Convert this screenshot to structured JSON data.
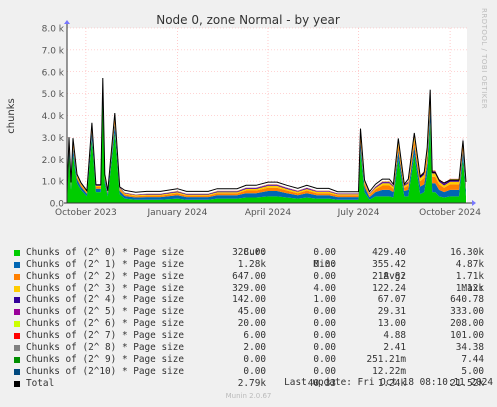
{
  "side_label": "RRDTOOL / TOBI OETIKER",
  "footer": {
    "last_update": "Last update: Fri Oct 18 08:10:11 2024",
    "generator": "Munin 2.0.67"
  },
  "legend_header": {
    "cur": "Cur:",
    "min": "Min:",
    "avg": "Avg:",
    "max": "Max:"
  },
  "legend": [
    {
      "name": "Chunks of (2^ 0) * Page size",
      "color": "#00cc00",
      "cur": "328.00",
      "min": "0.00",
      "avg": "429.40",
      "max": "16.30k"
    },
    {
      "name": "Chunks of (2^ 1) * Page size",
      "color": "#0066b3",
      "cur": "1.28k",
      "min": "0.00",
      "avg": "355.42",
      "max": "4.87k"
    },
    {
      "name": "Chunks of (2^ 2) * Page size",
      "color": "#ff8000",
      "cur": "647.00",
      "min": "0.00",
      "avg": "218.82",
      "max": "1.71k"
    },
    {
      "name": "Chunks of (2^ 3) * Page size",
      "color": "#ffcc00",
      "cur": "329.00",
      "min": "4.00",
      "avg": "122.24",
      "max": "1.12k"
    },
    {
      "name": "Chunks of (2^ 4) * Page size",
      "color": "#330099",
      "cur": "142.00",
      "min": "1.00",
      "avg": "67.07",
      "max": "640.78"
    },
    {
      "name": "Chunks of (2^ 5) * Page size",
      "color": "#990099",
      "cur": "45.00",
      "min": "0.00",
      "avg": "29.31",
      "max": "333.00"
    },
    {
      "name": "Chunks of (2^ 6) * Page size",
      "color": "#ccff00",
      "cur": "20.00",
      "min": "0.00",
      "avg": "13.00",
      "max": "208.00"
    },
    {
      "name": "Chunks of (2^ 7) * Page size",
      "color": "#ff0000",
      "cur": "6.00",
      "min": "0.00",
      "avg": "4.88",
      "max": "101.00"
    },
    {
      "name": "Chunks of (2^ 8) * Page size",
      "color": "#808080",
      "cur": "2.00",
      "min": "0.00",
      "avg": "2.41",
      "max": "34.38"
    },
    {
      "name": "Chunks of (2^ 9) * Page size",
      "color": "#008f00",
      "cur": "0.00",
      "min": "0.00",
      "avg": "251.21m",
      "max": "7.44"
    },
    {
      "name": "Chunks of (2^10) * Page size",
      "color": "#00487d",
      "cur": "0.00",
      "min": "0.00",
      "avg": "12.22m",
      "max": "5.00"
    },
    {
      "name": "Total",
      "color": "#000000",
      "cur": "2.79k",
      "min": "40.33",
      "avg": "1.24k",
      "max": "21.52k"
    }
  ],
  "chart_data": {
    "type": "area",
    "title": "Node 0, zone Normal - by year",
    "ylabel": "chunks",
    "ylim": [
      0,
      8000
    ],
    "xlim": [
      "2023-09-12",
      "2024-10-18"
    ],
    "yticks": [
      {
        "value": 0,
        "label": "0.0"
      },
      {
        "value": 1000,
        "label": "1.0 k"
      },
      {
        "value": 2000,
        "label": "2.0 k"
      },
      {
        "value": 3000,
        "label": "3.0 k"
      },
      {
        "value": 4000,
        "label": "4.0 k"
      },
      {
        "value": 5000,
        "label": "5.0 k"
      },
      {
        "value": 6000,
        "label": "6.0 k"
      },
      {
        "value": 7000,
        "label": "7.0 k"
      },
      {
        "value": 8000,
        "label": "8.0 k"
      }
    ],
    "xticks": [
      {
        "value": "2023-10-01",
        "label": "October 2023"
      },
      {
        "value": "2024-01-01",
        "label": "January 2024"
      },
      {
        "value": "2024-04-01",
        "label": "April 2024"
      },
      {
        "value": "2024-07-01",
        "label": "July 2024"
      },
      {
        "value": "2024-10-01",
        "label": "October 2024"
      }
    ],
    "grid": true,
    "x": [
      "2023-09-12",
      "2023-09-14",
      "2023-09-16",
      "2023-09-18",
      "2023-09-22",
      "2023-09-26",
      "2023-10-02",
      "2023-10-07",
      "2023-10-11",
      "2023-10-16",
      "2023-10-18",
      "2023-10-20",
      "2023-10-23",
      "2023-10-30",
      "2023-11-04",
      "2023-11-09",
      "2023-11-20",
      "2023-12-01",
      "2023-12-15",
      "2024-01-01",
      "2024-01-10",
      "2024-01-20",
      "2024-02-01",
      "2024-02-10",
      "2024-02-20",
      "2024-03-01",
      "2024-03-10",
      "2024-03-20",
      "2024-04-01",
      "2024-04-10",
      "2024-04-20",
      "2024-05-01",
      "2024-05-10",
      "2024-05-20",
      "2024-06-01",
      "2024-06-10",
      "2024-06-20",
      "2024-07-01",
      "2024-07-03",
      "2024-07-07",
      "2024-07-12",
      "2024-07-18",
      "2024-07-25",
      "2024-08-01",
      "2024-08-05",
      "2024-08-10",
      "2024-08-16",
      "2024-08-20",
      "2024-08-26",
      "2024-09-01",
      "2024-09-05",
      "2024-09-08",
      "2024-09-11",
      "2024-09-13",
      "2024-09-16",
      "2024-09-20",
      "2024-09-25",
      "2024-10-01",
      "2024-10-05",
      "2024-10-10",
      "2024-10-14",
      "2024-10-17"
    ],
    "series": [
      {
        "name": "Chunks of (2^ 0) * Page size",
        "color": "#00cc00",
        "values": [
          150,
          2300,
          600,
          2200,
          900,
          600,
          300,
          2900,
          500,
          500,
          4800,
          900,
          300,
          3200,
          400,
          200,
          150,
          150,
          150,
          200,
          150,
          150,
          150,
          200,
          200,
          200,
          250,
          250,
          300,
          300,
          250,
          200,
          250,
          200,
          200,
          150,
          150,
          150,
          2400,
          500,
          150,
          300,
          300,
          300,
          250,
          2000,
          300,
          300,
          2200,
          400,
          500,
          1300,
          3700,
          500,
          500,
          300,
          250,
          300,
          300,
          300,
          2000,
          300
        ]
      },
      {
        "name": "Chunks of (2^ 1) * Page size",
        "color": "#0066b3",
        "values": [
          100,
          300,
          150,
          350,
          200,
          150,
          120,
          350,
          150,
          150,
          400,
          200,
          120,
          400,
          150,
          120,
          100,
          120,
          120,
          150,
          120,
          120,
          120,
          150,
          150,
          150,
          200,
          200,
          250,
          250,
          200,
          150,
          200,
          150,
          150,
          120,
          120,
          120,
          400,
          250,
          120,
          200,
          300,
          300,
          250,
          400,
          250,
          300,
          400,
          350,
          350,
          500,
          600,
          400,
          400,
          300,
          250,
          300,
          300,
          300,
          400,
          300
        ]
      },
      {
        "name": "Chunks of (2^ 2) * Page size",
        "color": "#ff8000",
        "values": [
          60,
          200,
          80,
          200,
          100,
          80,
          60,
          200,
          80,
          80,
          250,
          100,
          60,
          250,
          80,
          70,
          60,
          70,
          70,
          90,
          70,
          70,
          70,
          90,
          90,
          90,
          120,
          120,
          150,
          150,
          120,
          100,
          120,
          100,
          100,
          80,
          80,
          80,
          300,
          150,
          80,
          120,
          200,
          200,
          150,
          250,
          150,
          200,
          300,
          250,
          300,
          350,
          400,
          300,
          300,
          250,
          200,
          250,
          250,
          250,
          300,
          200
        ]
      },
      {
        "name": "Chunks of (2^ 3) * Page size",
        "color": "#ffcc00",
        "values": [
          40,
          100,
          50,
          100,
          60,
          50,
          40,
          100,
          50,
          50,
          130,
          60,
          40,
          130,
          50,
          45,
          40,
          45,
          45,
          55,
          45,
          45,
          45,
          55,
          55,
          55,
          70,
          70,
          80,
          80,
          70,
          60,
          70,
          60,
          60,
          50,
          50,
          50,
          150,
          80,
          50,
          70,
          100,
          100,
          80,
          150,
          80,
          100,
          150,
          130,
          150,
          200,
          250,
          150,
          150,
          120,
          100,
          120,
          120,
          120,
          150,
          100
        ]
      },
      {
        "name": "Chunks of (2^ 4) * Page size",
        "color": "#330099",
        "values": [
          20,
          60,
          30,
          60,
          30,
          30,
          20,
          60,
          30,
          30,
          70,
          30,
          20,
          70,
          30,
          25,
          20,
          25,
          25,
          30,
          25,
          25,
          25,
          30,
          30,
          30,
          35,
          35,
          40,
          40,
          35,
          30,
          35,
          30,
          30,
          25,
          25,
          25,
          80,
          40,
          25,
          35,
          50,
          50,
          40,
          80,
          40,
          50,
          80,
          70,
          80,
          100,
          120,
          80,
          80,
          70,
          60,
          70,
          70,
          70,
          80,
          60
        ]
      },
      {
        "name": "Chunks of (2^ 5) * Page size",
        "color": "#990099",
        "values": [
          10,
          30,
          15,
          30,
          15,
          15,
          10,
          30,
          15,
          15,
          35,
          15,
          10,
          35,
          15,
          12,
          10,
          12,
          12,
          15,
          12,
          12,
          12,
          15,
          15,
          15,
          18,
          18,
          20,
          20,
          18,
          15,
          18,
          15,
          15,
          12,
          12,
          12,
          40,
          20,
          12,
          18,
          25,
          25,
          20,
          40,
          20,
          25,
          40,
          35,
          40,
          50,
          60,
          40,
          40,
          35,
          30,
          35,
          35,
          35,
          40,
          30
        ]
      },
      {
        "name": "Chunks of (2^ 6) * Page size",
        "color": "#ccff00",
        "values": [
          5,
          15,
          8,
          15,
          8,
          8,
          5,
          15,
          8,
          8,
          18,
          8,
          5,
          18,
          8,
          6,
          5,
          6,
          6,
          8,
          6,
          6,
          6,
          8,
          8,
          8,
          9,
          9,
          10,
          10,
          9,
          8,
          9,
          8,
          8,
          6,
          6,
          6,
          20,
          10,
          6,
          9,
          12,
          12,
          10,
          20,
          10,
          12,
          20,
          18,
          20,
          25,
          30,
          20,
          20,
          18,
          15,
          18,
          18,
          18,
          20,
          15
        ]
      },
      {
        "name": "Chunks of (2^ 7) * Page size",
        "color": "#ff0000",
        "values": [
          2,
          6,
          3,
          6,
          3,
          3,
          2,
          6,
          3,
          3,
          7,
          3,
          2,
          7,
          3,
          2,
          2,
          2,
          2,
          3,
          2,
          2,
          2,
          3,
          3,
          3,
          4,
          4,
          4,
          4,
          4,
          3,
          4,
          3,
          3,
          2,
          2,
          2,
          8,
          4,
          2,
          4,
          5,
          5,
          4,
          8,
          4,
          5,
          8,
          7,
          8,
          10,
          12,
          8,
          8,
          7,
          6,
          7,
          7,
          7,
          8,
          6
        ]
      },
      {
        "name": "Chunks of (2^ 8) * Page size",
        "color": "#808080",
        "values": [
          1,
          2,
          1,
          2,
          1,
          1,
          1,
          2,
          1,
          1,
          3,
          1,
          1,
          3,
          1,
          1,
          1,
          1,
          1,
          1,
          1,
          1,
          1,
          1,
          1,
          1,
          2,
          2,
          2,
          2,
          2,
          1,
          2,
          1,
          1,
          1,
          1,
          1,
          3,
          2,
          1,
          2,
          2,
          2,
          2,
          3,
          2,
          2,
          3,
          3,
          3,
          4,
          5,
          3,
          3,
          3,
          2,
          3,
          3,
          3,
          3,
          2
        ]
      },
      {
        "name": "Chunks of (2^ 9) * Page size",
        "color": "#008f00",
        "values": [
          0,
          1,
          0,
          1,
          0,
          0,
          0,
          1,
          0,
          0,
          1,
          0,
          0,
          1,
          0,
          0,
          0,
          0,
          0,
          0,
          0,
          0,
          0,
          0,
          0,
          0,
          0,
          0,
          0,
          0,
          0,
          0,
          0,
          0,
          0,
          0,
          0,
          0,
          1,
          0,
          0,
          0,
          0,
          0,
          0,
          1,
          0,
          0,
          1,
          0,
          1,
          1,
          2,
          0,
          0,
          0,
          0,
          0,
          0,
          0,
          1,
          0
        ]
      },
      {
        "name": "Chunks of (2^10) * Page size",
        "color": "#00487d",
        "values": [
          0,
          0,
          0,
          0,
          0,
          0,
          0,
          0,
          0,
          0,
          0,
          0,
          0,
          0,
          0,
          0,
          0,
          0,
          0,
          0,
          0,
          0,
          0,
          0,
          0,
          0,
          0,
          0,
          0,
          0,
          0,
          0,
          0,
          0,
          0,
          0,
          0,
          0,
          0,
          0,
          0,
          0,
          0,
          0,
          0,
          0,
          0,
          0,
          0,
          0,
          0,
          0,
          1,
          0,
          0,
          0,
          0,
          0,
          0,
          0,
          0,
          0
        ]
      }
    ],
    "total": {
      "name": "Total",
      "color": "#000000",
      "values": [
        388,
        3014,
        937,
        2964,
        1317,
        937,
        558,
        3664,
        837,
        837,
        5714,
        1317,
        558,
        4114,
        737,
        581,
        488,
        531,
        531,
        652,
        531,
        531,
        531,
        652,
        652,
        652,
        808,
        808,
        956,
        956,
        808,
        667,
        808,
        667,
        667,
        516,
        516,
        516,
        3402,
        1056,
        516,
        858,
        1094,
        1094,
        856,
        2952,
        856,
        1094,
        3202,
        1213,
        1402,
        2540,
        5180,
        1401,
        1401,
        1053,
        913,
        1053,
        1053,
        1053,
        2852,
        963
      ]
    }
  }
}
